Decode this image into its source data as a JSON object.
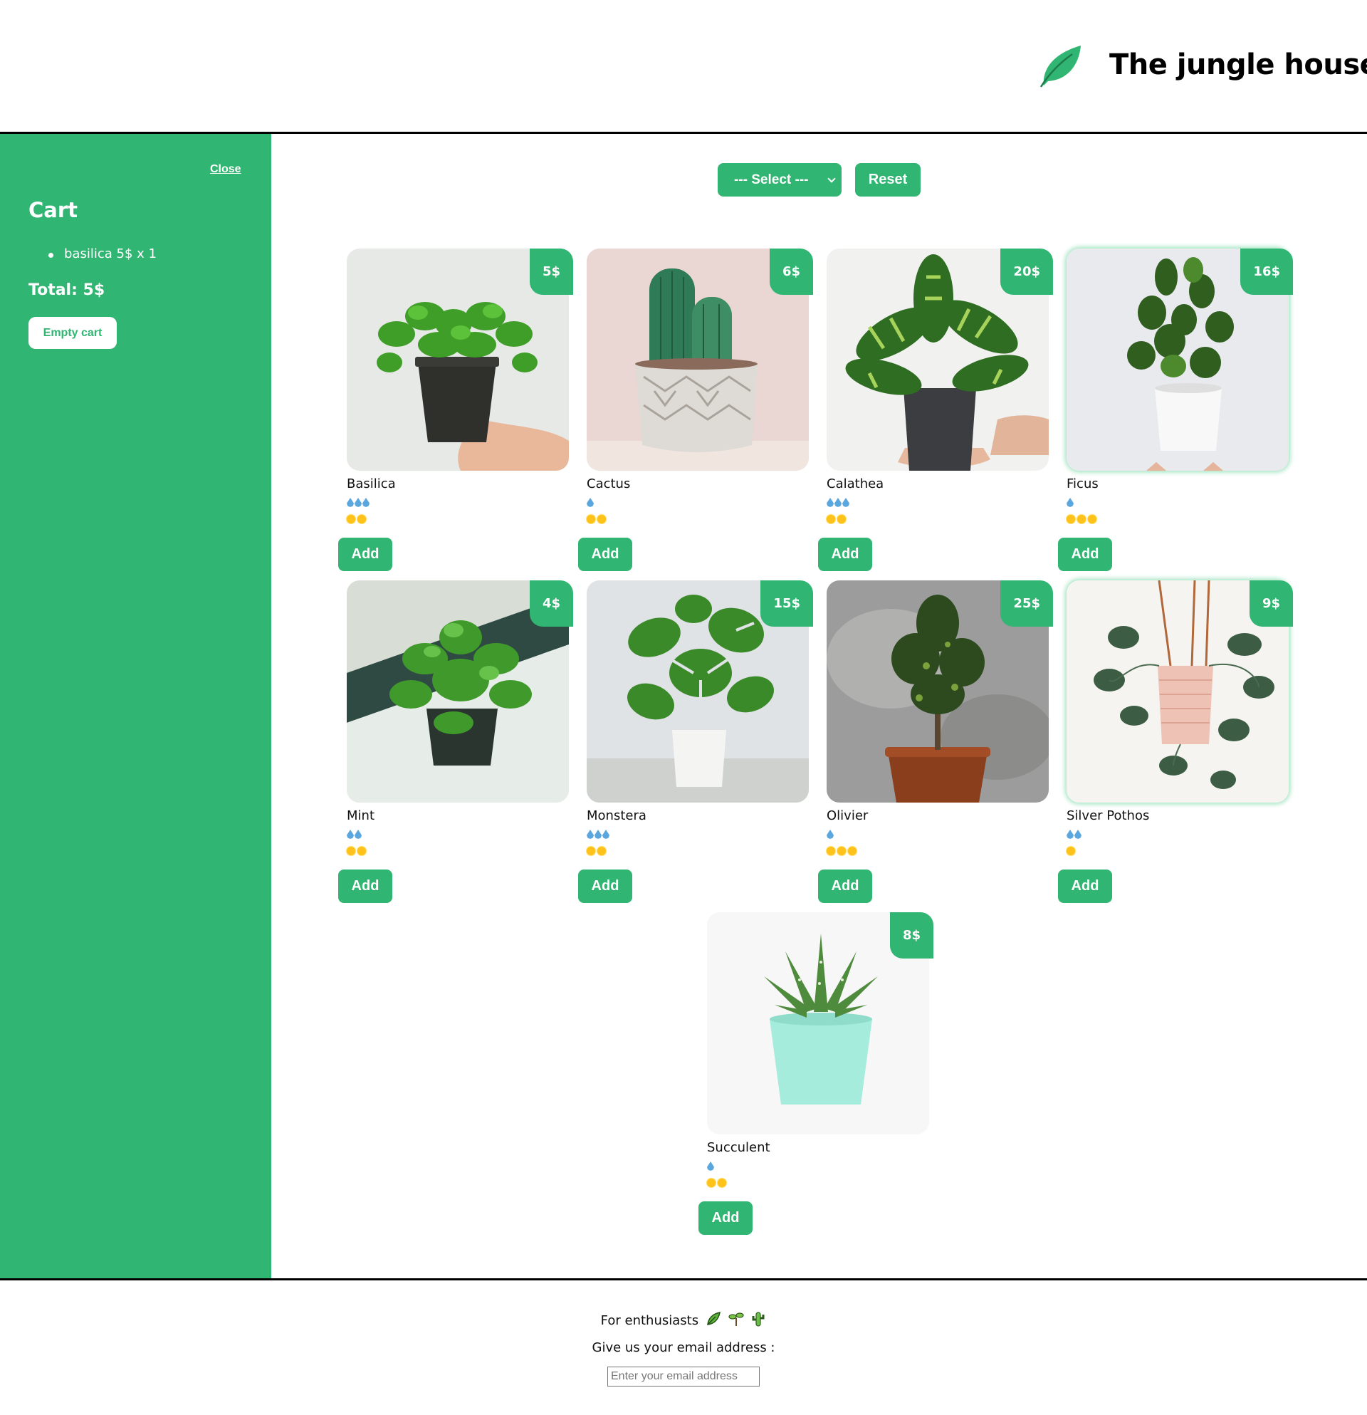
{
  "header": {
    "site_title": "The jungle house",
    "logo_icon": "leaf-icon"
  },
  "cart": {
    "close_label": "Close",
    "title": "Cart",
    "items": [
      {
        "text": "basilica 5$ x 1"
      }
    ],
    "total": "Total: 5$",
    "empty_label": "Empty cart"
  },
  "filter": {
    "selected": "--- Select ---",
    "reset_label": "Reset"
  },
  "colors": {
    "accent": "#31b572",
    "water": "#5aa7e0",
    "sun": "#ffc21a"
  },
  "plants": [
    {
      "name": "Basilica",
      "price": "5$",
      "water": 3,
      "light": 2,
      "add_label": "Add"
    },
    {
      "name": "Cactus",
      "price": "6$",
      "water": 1,
      "light": 2,
      "add_label": "Add"
    },
    {
      "name": "Calathea",
      "price": "20$",
      "water": 3,
      "light": 2,
      "add_label": "Add"
    },
    {
      "name": "Ficus",
      "price": "16$",
      "water": 1,
      "light": 3,
      "add_label": "Add"
    },
    {
      "name": "Mint",
      "price": "4$",
      "water": 2,
      "light": 2,
      "add_label": "Add"
    },
    {
      "name": "Monstera",
      "price": "15$",
      "water": 3,
      "light": 2,
      "add_label": "Add"
    },
    {
      "name": "Olivier",
      "price": "25$",
      "water": 1,
      "light": 3,
      "add_label": "Add"
    },
    {
      "name": "Silver Pothos",
      "price": "9$",
      "water": 2,
      "light": 1,
      "add_label": "Add"
    },
    {
      "name": "Succulent",
      "price": "8$",
      "water": 1,
      "light": 2,
      "add_label": "Add"
    }
  ],
  "footer": {
    "title": "For enthusiasts",
    "email_prompt": "Give us your email address :",
    "email_placeholder": "Enter your email address",
    "email_value": ""
  }
}
